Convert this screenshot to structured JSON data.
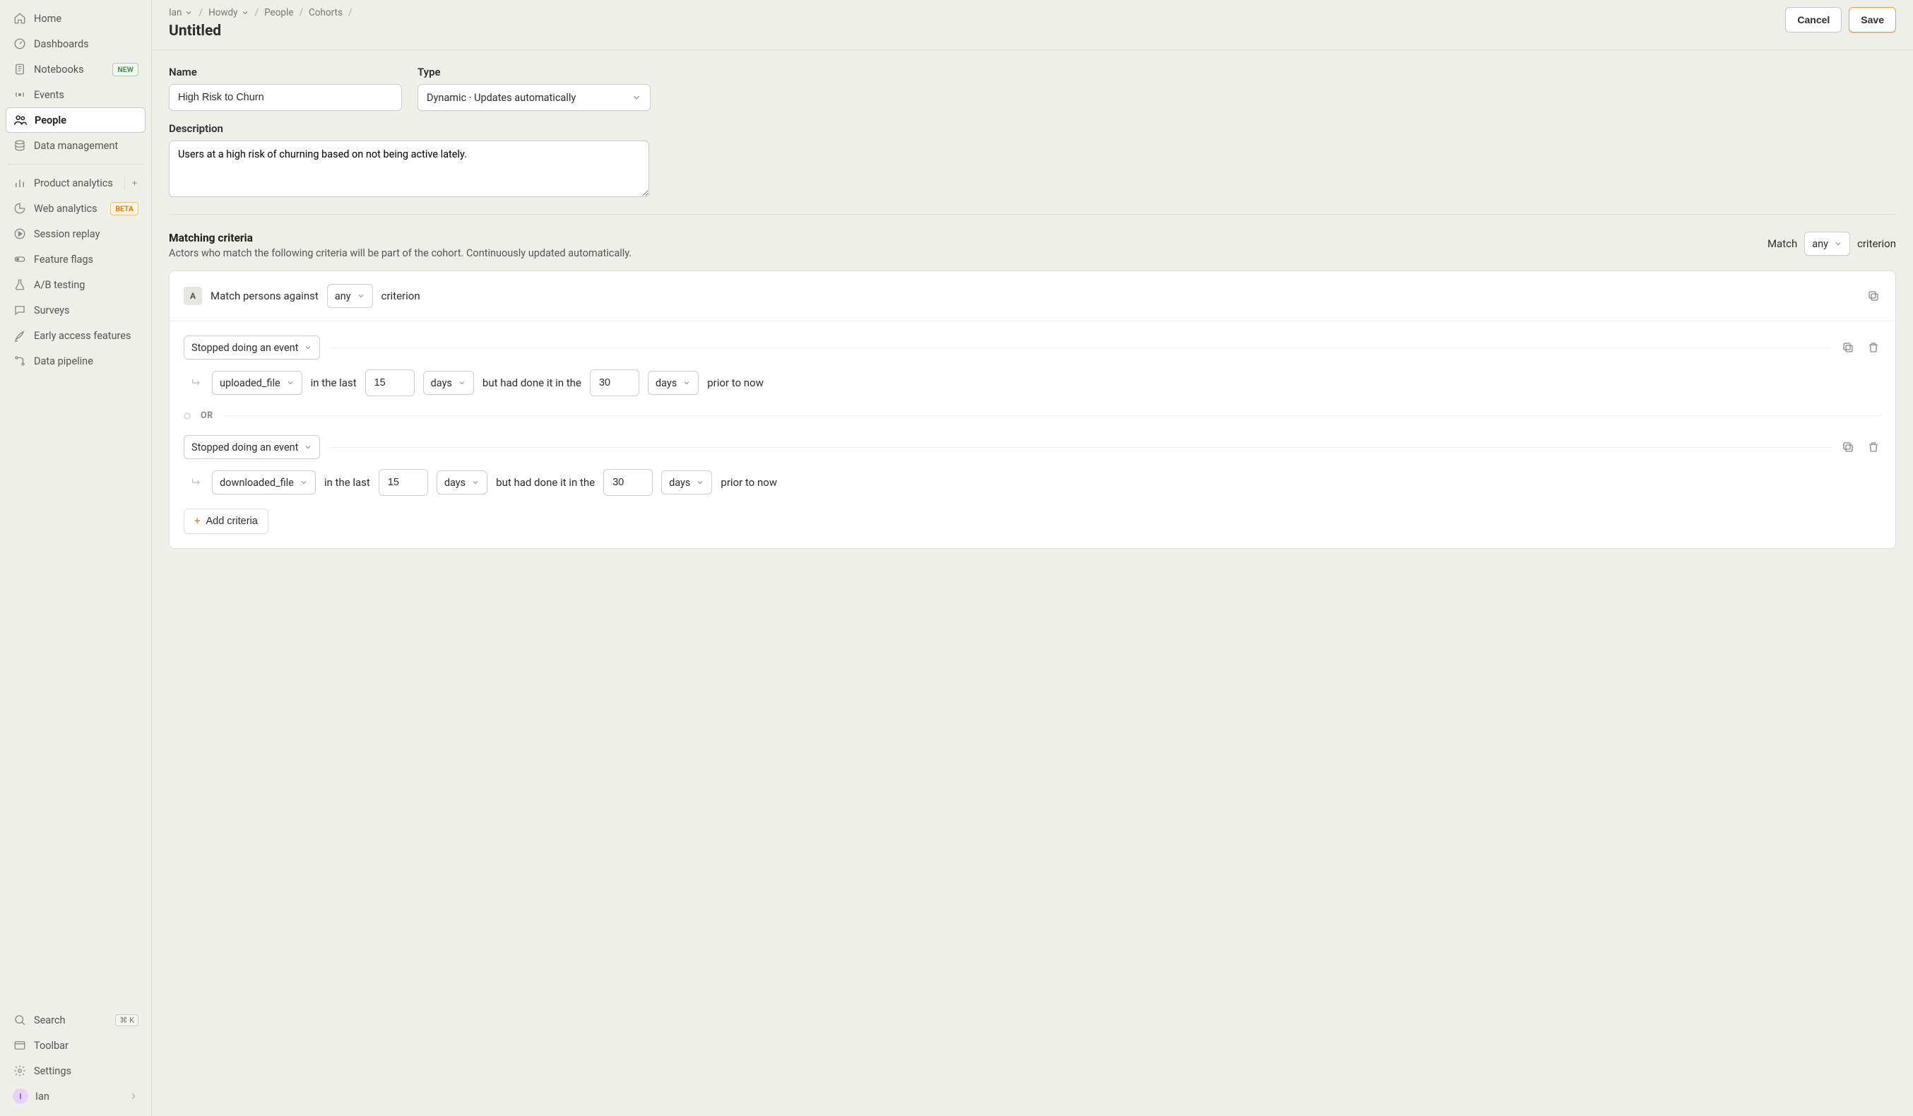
{
  "sidebar": {
    "top": [
      {
        "label": "Home"
      },
      {
        "label": "Dashboards"
      },
      {
        "label": "Notebooks",
        "badge": "NEW"
      },
      {
        "label": "Events"
      },
      {
        "label": "People"
      },
      {
        "label": "Data management"
      }
    ],
    "products": [
      {
        "label": "Product analytics",
        "plus": true
      },
      {
        "label": "Web analytics",
        "badge": "BETA"
      },
      {
        "label": "Session replay"
      },
      {
        "label": "Feature flags"
      },
      {
        "label": "A/B testing"
      },
      {
        "label": "Surveys"
      },
      {
        "label": "Early access features"
      },
      {
        "label": "Data pipeline"
      }
    ],
    "bottom": {
      "search": "Search",
      "search_kbd": "⌘ K",
      "toolbar": "Toolbar",
      "settings": "Settings",
      "user": "Ian"
    }
  },
  "breadcrumbs": [
    "Ian",
    "Howdy",
    "People",
    "Cohorts"
  ],
  "page_title": "Untitled",
  "actions": {
    "cancel": "Cancel",
    "save": "Save"
  },
  "form": {
    "name_label": "Name",
    "name_value": "High Risk to Churn",
    "type_label": "Type",
    "type_value": "Dynamic · Updates automatically",
    "desc_label": "Description",
    "desc_value": "Users at a high risk of churning based on not being active lately."
  },
  "criteria": {
    "title": "Matching criteria",
    "desc": "Actors who match the following criteria will be part of the cohort. Continuously updated automatically.",
    "match_label": "Match",
    "match_mode": "any",
    "match_suffix": "criterion",
    "group_letter": "A",
    "group_text_pre": "Match persons against",
    "group_mode": "any",
    "group_text_post": "criterion",
    "or_label": "OR",
    "add_label": "Add criteria",
    "rules": [
      {
        "behavior": "Stopped doing an event",
        "event": "uploaded_file",
        "t1_pre": "in the last",
        "t1_n": "15",
        "t1_unit": "days",
        "t2_pre": "but had done it in the",
        "t2_n": "30",
        "t2_unit": "days",
        "t2_post": "prior to now"
      },
      {
        "behavior": "Stopped doing an event",
        "event": "downloaded_file",
        "t1_pre": "in the last",
        "t1_n": "15",
        "t1_unit": "days",
        "t2_pre": "but had done it in the",
        "t2_n": "30",
        "t2_unit": "days",
        "t2_post": "prior to now"
      }
    ]
  }
}
